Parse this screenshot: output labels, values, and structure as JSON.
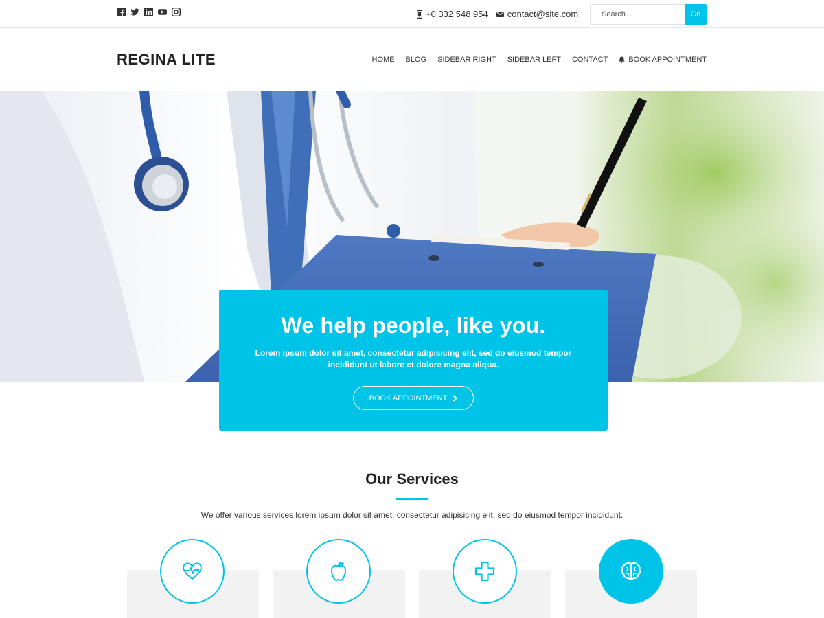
{
  "topbar": {
    "social_icons": [
      "facebook-icon",
      "twitter-icon",
      "linkedin-icon",
      "youtube-icon",
      "instagram-icon"
    ],
    "phone": "+0 332 548 954",
    "email": "contact@site.com",
    "search": {
      "placeholder": "Search...",
      "button_label": "Go"
    }
  },
  "header": {
    "logo": "REGINA LITE",
    "nav": [
      "HOME",
      "BLOG",
      "SIDEBAR RIGHT",
      "SIDEBAR LEFT",
      "CONTACT",
      "BOOK APPOINTMENT"
    ]
  },
  "hero": {
    "title": "We help people, like you.",
    "text": "Lorem ipsum dolor sit amet, consectetur adipisicing elit, sed do eiusmod tempor incididunt ut labore et dolore magna aliqua.",
    "button_label": "BOOK APPOINTMENT"
  },
  "services": {
    "title": "Our Services",
    "description": "We offer various services lorem ipsum dolor sit amet, consectetur adipisicing elit, sed do eiusmod tempor incididunt.",
    "icons": [
      "heartbeat-icon",
      "apple-icon",
      "medical-cross-icon",
      "brain-icon"
    ]
  },
  "colors": {
    "accent": "#00c3e8",
    "text": "#333333",
    "card": "#f2f2f2"
  }
}
